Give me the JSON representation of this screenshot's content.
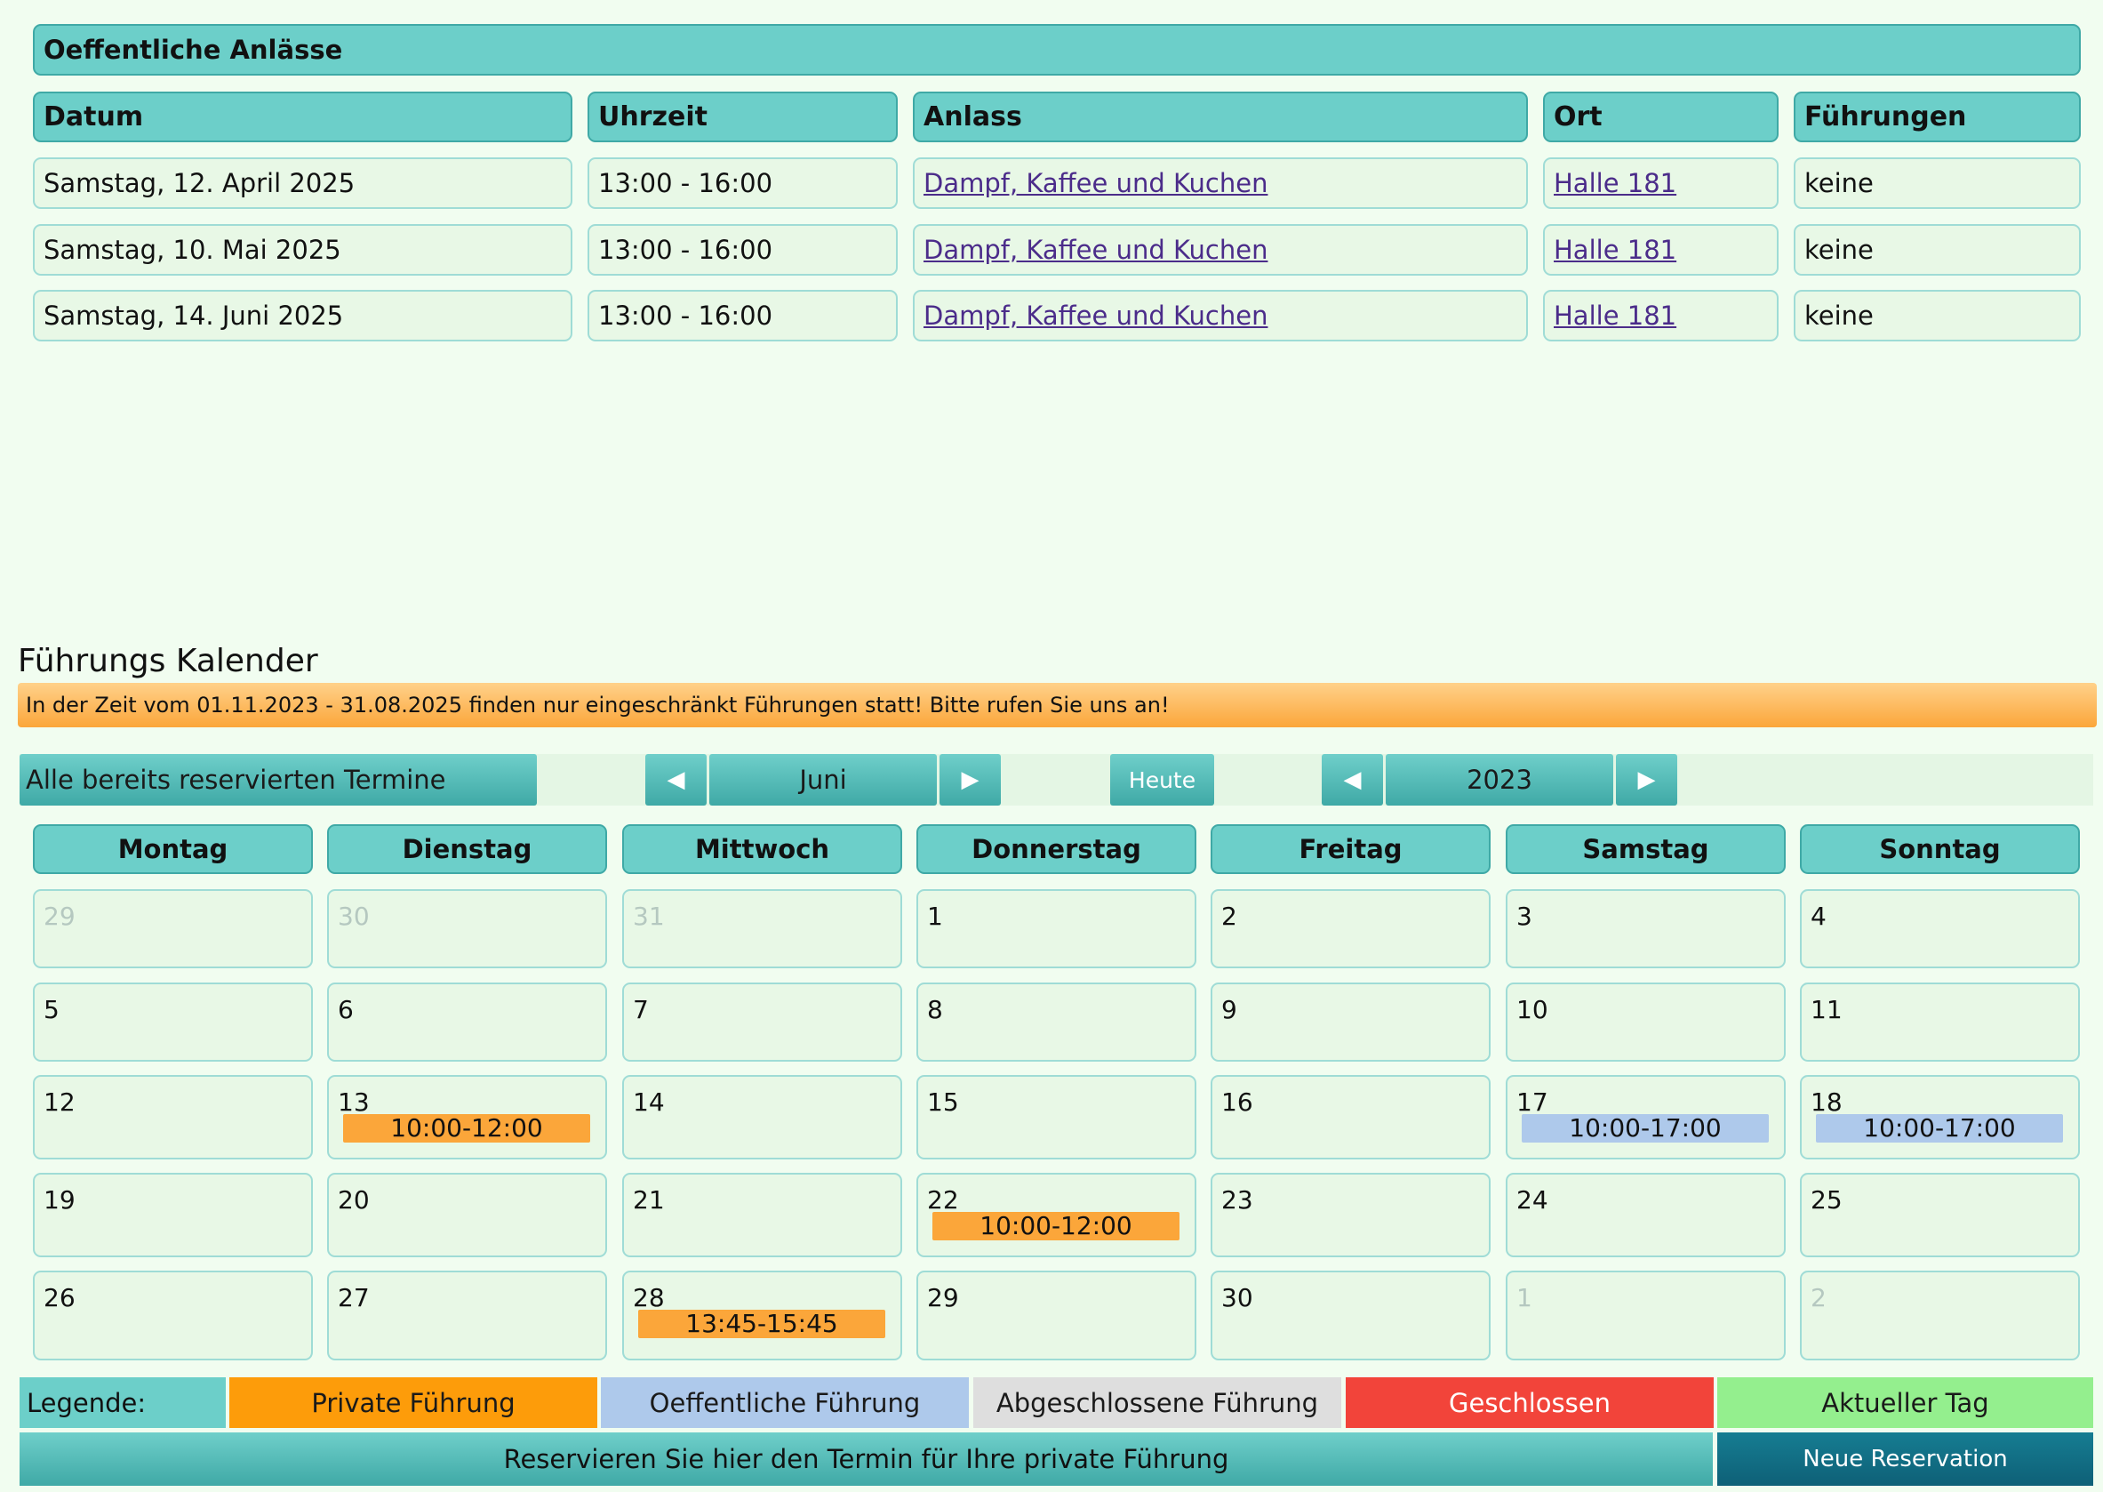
{
  "events": {
    "title": "Oeffentliche Anlässe",
    "headers": [
      "Datum",
      "Uhrzeit",
      "Anlass",
      "Ort",
      "Führungen"
    ],
    "rows": [
      {
        "datum": "Samstag, 12. April 2025",
        "uhrzeit": "13:00 - 16:00",
        "anlass": "Dampf, Kaffee und Kuchen",
        "ort": "Halle 181",
        "fuehrungen": "keine"
      },
      {
        "datum": "Samstag, 10. Mai 2025",
        "uhrzeit": "13:00 - 16:00",
        "anlass": "Dampf, Kaffee und Kuchen",
        "ort": "Halle 181",
        "fuehrungen": "keine"
      },
      {
        "datum": "Samstag, 14. Juni 2025",
        "uhrzeit": "13:00 - 16:00",
        "anlass": "Dampf, Kaffee und Kuchen",
        "ort": "Halle 181",
        "fuehrungen": "keine"
      }
    ]
  },
  "calendar": {
    "title": "Führungs Kalender",
    "notice": "In der Zeit vom 01.11.2023 - 31.08.2025 finden nur eingeschränkt Führungen statt! Bitte rufen Sie uns an!",
    "all_reserved_label": "Alle bereits reservierten Termine",
    "prev_symbol": "◀",
    "next_symbol": "▶",
    "month": "Juni",
    "today_label": "Heute",
    "year": "2023",
    "weekdays": [
      "Montag",
      "Dienstag",
      "Mittwoch",
      "Donnerstag",
      "Freitag",
      "Samstag",
      "Sonntag"
    ],
    "weeks": [
      [
        {
          "day": "29",
          "other": true
        },
        {
          "day": "30",
          "other": true
        },
        {
          "day": "31",
          "other": true
        },
        {
          "day": "1"
        },
        {
          "day": "2"
        },
        {
          "day": "3"
        },
        {
          "day": "4"
        }
      ],
      [
        {
          "day": "5"
        },
        {
          "day": "6"
        },
        {
          "day": "7"
        },
        {
          "day": "8"
        },
        {
          "day": "9"
        },
        {
          "day": "10"
        },
        {
          "day": "11"
        }
      ],
      [
        {
          "day": "12"
        },
        {
          "day": "13",
          "event": {
            "time": "10:00-12:00",
            "type": "private"
          }
        },
        {
          "day": "14"
        },
        {
          "day": "15"
        },
        {
          "day": "16"
        },
        {
          "day": "17",
          "event": {
            "time": "10:00-17:00",
            "type": "public"
          }
        },
        {
          "day": "18",
          "event": {
            "time": "10:00-17:00",
            "type": "public"
          }
        }
      ],
      [
        {
          "day": "19"
        },
        {
          "day": "20"
        },
        {
          "day": "21"
        },
        {
          "day": "22",
          "event": {
            "time": "10:00-12:00",
            "type": "private"
          }
        },
        {
          "day": "23"
        },
        {
          "day": "24"
        },
        {
          "day": "25"
        }
      ],
      [
        {
          "day": "26"
        },
        {
          "day": "27"
        },
        {
          "day": "28",
          "event": {
            "time": "13:45-15:45",
            "type": "private"
          }
        },
        {
          "day": "29"
        },
        {
          "day": "30"
        },
        {
          "day": "1",
          "other": true
        },
        {
          "day": "2",
          "other": true
        }
      ]
    ]
  },
  "legend": {
    "label": "Legende:",
    "items": [
      {
        "label": "Private Führung",
        "color": "#fd9c0a",
        "text_color": "#1a1a1a"
      },
      {
        "label": "Oeffentliche Führung",
        "color": "#aec9eb",
        "text_color": "#1a1a1a"
      },
      {
        "label": "Abgeschlossene Führung",
        "color": "#dedede",
        "text_color": "#1a1a1a"
      },
      {
        "label": "Geschlossen",
        "color": "#f2443a",
        "text_color": "#ffffff"
      },
      {
        "label": "Aktueller Tag",
        "color": "#94ef8e",
        "text_color": "#1a1a1a"
      }
    ]
  },
  "reservation": {
    "info": "Reservieren Sie hier den Termin für Ihre private Führung",
    "button": "Neue Reservation"
  }
}
